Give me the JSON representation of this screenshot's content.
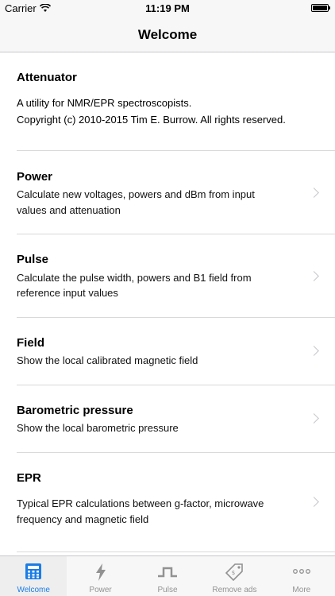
{
  "status": {
    "carrier": "Carrier",
    "time": "11:19 PM"
  },
  "nav": {
    "title": "Welcome"
  },
  "intro": {
    "title": "Attenuator",
    "line1": "A utility for NMR/EPR spectroscopists.",
    "line2": "Copyright (c) 2010-2015 Tim E. Burrow. All rights reserved."
  },
  "rows": [
    {
      "title": "Power",
      "desc1": "Calculate new voltages, powers and dBm from input",
      "desc2": "values and attenuation"
    },
    {
      "title": "Pulse",
      "desc1": "Calculate the pulse width, powers and B1 field from",
      "desc2": "reference input values"
    },
    {
      "title": "Field",
      "desc1": "Show the local calibrated magnetic field",
      "desc2": ""
    },
    {
      "title": "Barometric pressure",
      "desc1": "Show the local barometric pressure",
      "desc2": ""
    },
    {
      "title": "EPR",
      "desc1": "Typical EPR calculations between g-factor, microwave",
      "desc2": "frequency and magnetic field"
    }
  ],
  "tabs": [
    {
      "label": "Welcome",
      "icon": "calculator-icon",
      "active": true
    },
    {
      "label": "Power",
      "icon": "lightning-icon",
      "active": false
    },
    {
      "label": "Pulse",
      "icon": "pulse-icon",
      "active": false
    },
    {
      "label": "Remove ads",
      "icon": "price-tag-icon",
      "active": false
    },
    {
      "label": "More",
      "icon": "more-icon",
      "active": false
    }
  ],
  "colors": {
    "accent": "#1b7de6",
    "inactive": "#929292",
    "separator": "#d9d9d9"
  }
}
